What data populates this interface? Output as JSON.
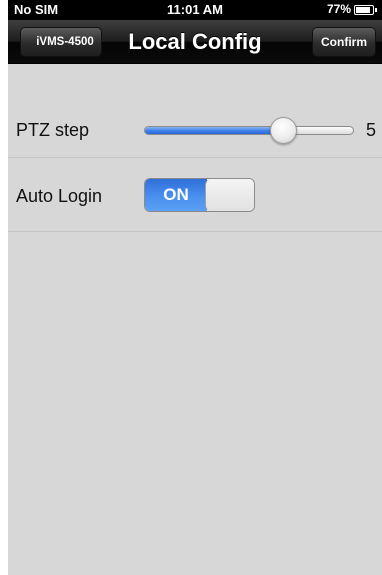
{
  "status_bar": {
    "carrier": "No SIM",
    "time": "11:01 AM",
    "battery_percent": "77%"
  },
  "nav": {
    "back_label": "iVMS-4500",
    "title": "Local Config",
    "confirm_label": "Confirm"
  },
  "settings": {
    "ptz_step": {
      "label": "PTZ step",
      "value": "5",
      "slider_fraction": 0.67
    },
    "auto_login": {
      "label": "Auto Login",
      "state": "ON"
    }
  },
  "colors": {
    "accent": "#3a7ee8",
    "background": "#d7d7d7"
  }
}
